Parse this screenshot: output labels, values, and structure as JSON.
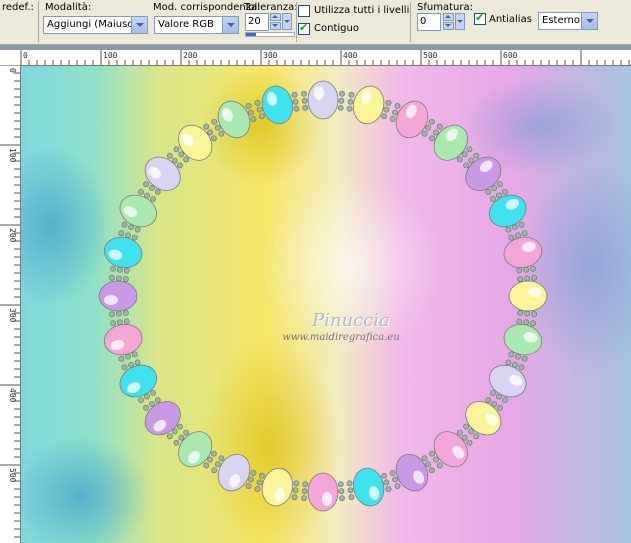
{
  "toolbar": {
    "presets_label": "redef.:",
    "mode": {
      "label": "Modalità:",
      "value": "Aggiungi (Maiusc)"
    },
    "match_mode": {
      "label": "Mod. corrispondenza:",
      "value": "Valore RGB"
    },
    "tolerance": {
      "label": "Tolleranza:",
      "value": "20",
      "progress": 0.2
    },
    "use_all_layers": {
      "label": "Utilizza tutti i livelli",
      "checked": false
    },
    "contiguous": {
      "label": "Contiguo",
      "checked": true
    },
    "feather": {
      "label": "Sfumatura:",
      "value": "0"
    },
    "antialias": {
      "label": "Antialias",
      "checked": true
    },
    "antialias_mode": {
      "value": "Esterno"
    }
  },
  "ruler": {
    "top_labels": [
      "0",
      "100",
      "200",
      "300",
      "400",
      "500",
      "600"
    ],
    "left_labels": [
      "0",
      "100",
      "200",
      "300",
      "400",
      "500"
    ]
  },
  "canvas": {
    "watermark_title": "Pinuccia",
    "watermark_url": "www.maidiregrafica.eu",
    "colors": {
      "cyan": "#3fe3f0",
      "pink": "#f5a6d8",
      "purple": "#c89ae6",
      "green": "#a9e9b0",
      "yellow": "#fbf59a",
      "lavender": "#d9d4f4"
    }
  }
}
